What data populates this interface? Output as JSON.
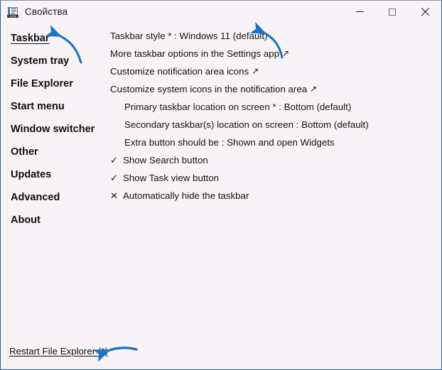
{
  "window": {
    "title": "Свойства",
    "icon": "taskbar-properties-icon",
    "controls": {
      "minimize": "—",
      "maximize": "□",
      "close": "✕"
    },
    "border_color": "#2f5c94",
    "background_color": "#f7f3f6"
  },
  "sidebar": {
    "items": [
      {
        "label": "Taskbar",
        "selected": true
      },
      {
        "label": "System tray",
        "selected": false
      },
      {
        "label": "File Explorer",
        "selected": false
      },
      {
        "label": "Start menu",
        "selected": false
      },
      {
        "label": "Window switcher",
        "selected": false
      },
      {
        "label": "Other",
        "selected": false
      },
      {
        "label": "Updates",
        "selected": false
      },
      {
        "label": "Advanced",
        "selected": false
      },
      {
        "label": "About",
        "selected": false
      }
    ]
  },
  "content": {
    "rows": [
      {
        "text": "Taskbar style * : Windows 11 (default)",
        "ext": "",
        "indent": 0,
        "mark": ""
      },
      {
        "text": "More taskbar options in the Settings app",
        "ext": "↗",
        "indent": 0,
        "mark": ""
      },
      {
        "text": "Customize notification area icons",
        "ext": "↗",
        "indent": 0,
        "mark": ""
      },
      {
        "text": "Customize system icons in the notification area",
        "ext": "↗",
        "indent": 0,
        "mark": ""
      },
      {
        "text": "Primary taskbar location on screen * : Bottom (default)",
        "ext": "",
        "indent": 1,
        "mark": ""
      },
      {
        "text": "Secondary taskbar(s) location on screen : Bottom (default)",
        "ext": "",
        "indent": 1,
        "mark": ""
      },
      {
        "text": "Extra button should be : Shown and open Widgets",
        "ext": "",
        "indent": 1,
        "mark": ""
      },
      {
        "text": "Show Search button",
        "ext": "",
        "indent": 0,
        "mark": "✓"
      },
      {
        "text": "Show Task view button",
        "ext": "",
        "indent": 0,
        "mark": "✓"
      },
      {
        "text": "Automatically hide the taskbar",
        "ext": "",
        "indent": 0,
        "mark": "✕"
      }
    ]
  },
  "footer": {
    "restart_link": "Restart File Explorer (*)"
  },
  "annotations": {
    "color": "#1e72c4",
    "arrows": [
      {
        "name": "arrow-to-taskbar-nav",
        "points_to": "Taskbar"
      },
      {
        "name": "arrow-to-taskbar-style",
        "points_to": "Taskbar style * : Windows 11 (default)"
      },
      {
        "name": "arrow-to-restart-link",
        "points_to": "Restart File Explorer (*)"
      }
    ]
  }
}
